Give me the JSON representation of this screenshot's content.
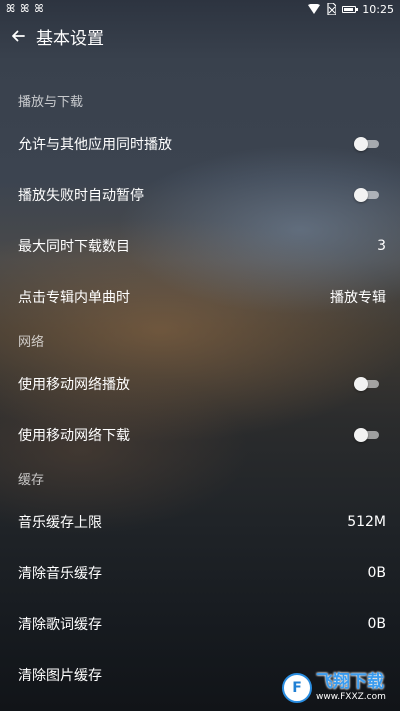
{
  "status_bar": {
    "notification_icons": [
      "app-notification-icon",
      "app-notification-icon",
      "app-notification-icon"
    ],
    "time": "10:25"
  },
  "header": {
    "title": "基本设置"
  },
  "sections": {
    "playback": {
      "title": "播放与下载",
      "items": [
        {
          "label": "允许与其他应用同时播放",
          "type": "toggle",
          "on": false
        },
        {
          "label": "播放失败时自动暂停",
          "type": "toggle",
          "on": false
        },
        {
          "label": "最大同时下载数目",
          "type": "value",
          "value": "3"
        },
        {
          "label": "点击专辑内单曲时",
          "type": "value",
          "value": "播放专辑"
        }
      ]
    },
    "network": {
      "title": "网络",
      "items": [
        {
          "label": "使用移动网络播放",
          "type": "toggle",
          "on": false
        },
        {
          "label": "使用移动网络下载",
          "type": "toggle",
          "on": false
        }
      ]
    },
    "cache": {
      "title": "缓存",
      "items": [
        {
          "label": "音乐缓存上限",
          "type": "value",
          "value": "512M"
        },
        {
          "label": "清除音乐缓存",
          "type": "value",
          "value": "0B"
        },
        {
          "label": "清除歌词缓存",
          "type": "value",
          "value": "0B"
        },
        {
          "label": "清除图片缓存",
          "type": "value",
          "value": ""
        }
      ]
    }
  },
  "watermark": {
    "text": "飞翔下载",
    "url": "www.FXXZ.com"
  }
}
